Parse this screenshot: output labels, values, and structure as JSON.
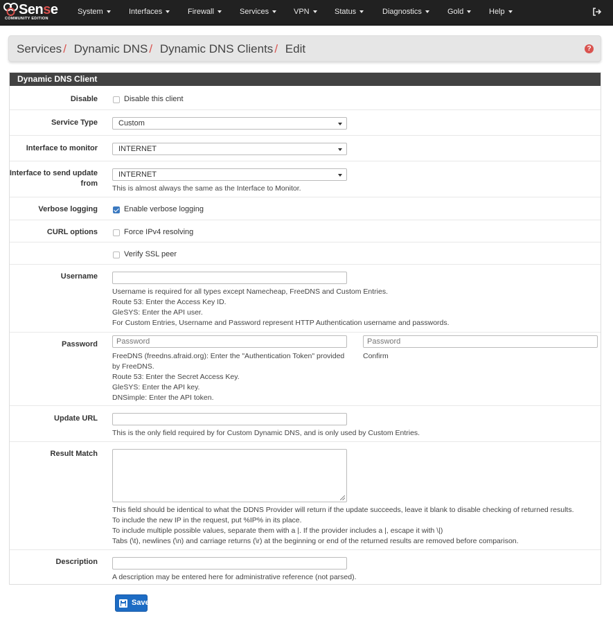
{
  "nav": {
    "logo_main": "Sense",
    "logo_sub": "COMMUNITY EDITION",
    "items": [
      "System",
      "Interfaces",
      "Firewall",
      "Services",
      "VPN",
      "Status",
      "Diagnostics",
      "Gold",
      "Help"
    ]
  },
  "breadcrumb": [
    "Services",
    "Dynamic DNS",
    "Dynamic DNS Clients",
    "Edit"
  ],
  "panel_title": "Dynamic DNS Client",
  "form": {
    "disable": {
      "label": "Disable",
      "checkbox": "Disable this client",
      "checked": false
    },
    "service_type": {
      "label": "Service Type",
      "value": "Custom"
    },
    "interface_monitor": {
      "label": "Interface to monitor",
      "value": "INTERNET"
    },
    "interface_send": {
      "label": "Interface to send update from",
      "value": "INTERNET",
      "help": "This is almost always the same as the Interface to Monitor."
    },
    "verbose": {
      "label": "Verbose logging",
      "checkbox": "Enable verbose logging",
      "checked": true
    },
    "curl": {
      "label": "CURL options",
      "opt1": "Force IPv4 resolving",
      "opt2": "Verify SSL peer"
    },
    "username": {
      "label": "Username",
      "value": "",
      "help": [
        "Username is required for all types except Namecheap, FreeDNS and Custom Entries.",
        "Route 53: Enter the Access Key ID.",
        "GleSYS: Enter the API user.",
        "For Custom Entries, Username and Password represent HTTP Authentication username and passwords."
      ]
    },
    "password": {
      "label": "Password",
      "placeholder": "Password",
      "confirm_placeholder": "Password",
      "confirm_label": "Confirm",
      "help": [
        "FreeDNS (freedns.afraid.org): Enter the \"Authentication Token\" provided",
        "by FreeDNS.",
        "Route 53: Enter the Secret Access Key.",
        "GleSYS: Enter the API key.",
        "DNSimple: Enter the API token."
      ]
    },
    "update_url": {
      "label": "Update URL",
      "value": "",
      "help": "This is the only field required by for Custom Dynamic DNS, and is only used by Custom Entries."
    },
    "result_match": {
      "label": "Result Match",
      "help": [
        "This field should be identical to what the DDNS Provider will return if the update succeeds, leave it blank to disable checking of returned results.",
        "To include the new IP in the request, put %IP% in its place.",
        "To include multiple possible values, separate them with a |. If the provider includes a |, escape it with \\|)",
        "Tabs (\\t), newlines (\\n) and carriage returns (\\r) at the beginning or end of the returned results are removed before comparison."
      ]
    },
    "description": {
      "label": "Description",
      "value": "",
      "help": "A description may be entered here for administrative reference (not parsed)."
    }
  },
  "save_label": "Save",
  "colors": {
    "navbar": "#212121",
    "accent_red": "#d9534f",
    "primary_blue": "#1d6cc4",
    "panel_header": "#424242"
  }
}
